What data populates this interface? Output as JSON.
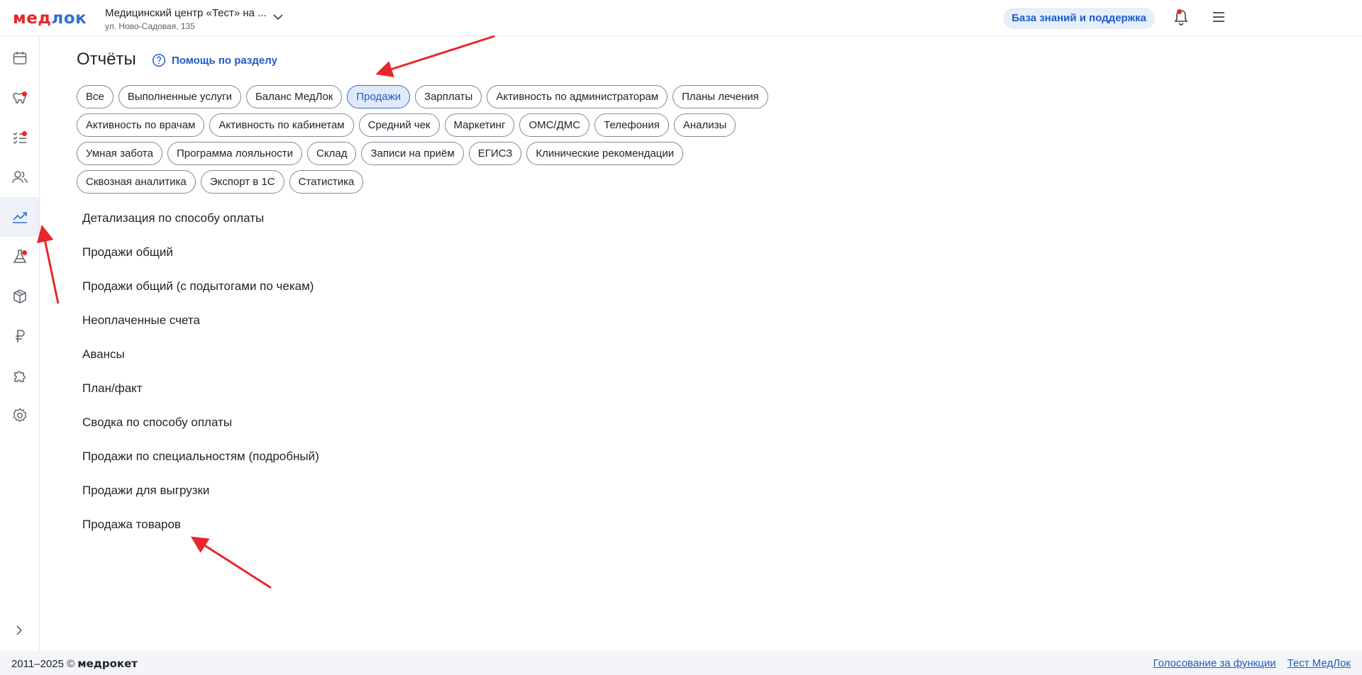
{
  "header": {
    "logo_part1": "мед",
    "logo_part2": "лок",
    "clinic_name": "Медицинский центр «Тест» на ...",
    "clinic_address": "ул. Ново-Садовая, 135",
    "knowledge_button": "База знаний и поддержка",
    "notification_dot_color": "#e8262c"
  },
  "sidebar": {
    "items": [
      {
        "icon": "calendar-icon",
        "active": false,
        "badge": false
      },
      {
        "icon": "teeth-map-icon",
        "active": false,
        "badge": true
      },
      {
        "icon": "task-list-icon",
        "active": false,
        "badge": true
      },
      {
        "icon": "users-icon",
        "active": false,
        "badge": false
      },
      {
        "icon": "chart-icon",
        "active": true,
        "badge": false
      },
      {
        "icon": "flask-icon",
        "active": false,
        "badge": true
      },
      {
        "icon": "box-icon",
        "active": false,
        "badge": false
      },
      {
        "icon": "ruble-icon",
        "active": false,
        "badge": false
      },
      {
        "icon": "puzzle-icon",
        "active": false,
        "badge": false
      },
      {
        "icon": "gear-icon",
        "active": false,
        "badge": false
      }
    ]
  },
  "main": {
    "title": "Отчёты",
    "help_label": "Помощь по разделу",
    "active_filter": "Продажи",
    "filter_rows": [
      [
        "Все",
        "Выполненные услуги",
        "Баланс МедЛок",
        "Продажи",
        "Зарплаты",
        "Активность по администраторам",
        "Планы лечения"
      ],
      [
        "Активность по врачам",
        "Активность по кабинетам",
        "Средний чек",
        "Маркетинг",
        "ОМС/ДМС",
        "Телефония",
        "Анализы"
      ],
      [
        "Умная забота",
        "Программа лояльности",
        "Склад",
        "Записи на приём",
        "ЕГИСЗ",
        "Клинические рекомендации"
      ],
      [
        "Сквозная аналитика",
        "Экспорт в 1С",
        "Статистика"
      ]
    ],
    "reports": [
      "Детализация по способу оплаты",
      "Продажи общий",
      "Продажи общий (с подытогами по чекам)",
      "Неоплаченные счета",
      "Авансы",
      "План/факт",
      "Сводка по способу оплаты",
      "Продажи по специальностям (подробный)",
      "Продажи для выгрузки",
      "Продажа товаров"
    ]
  },
  "footer": {
    "copyright_prefix": "2011–2025 © ",
    "copyright_brand": "медрокет",
    "links": [
      "Голосование за функции",
      "Тест МедЛок"
    ]
  },
  "colors": {
    "brand_red": "#e8262c",
    "brand_blue": "#2f6fd6",
    "annotation_arrow": "#e8262c"
  }
}
